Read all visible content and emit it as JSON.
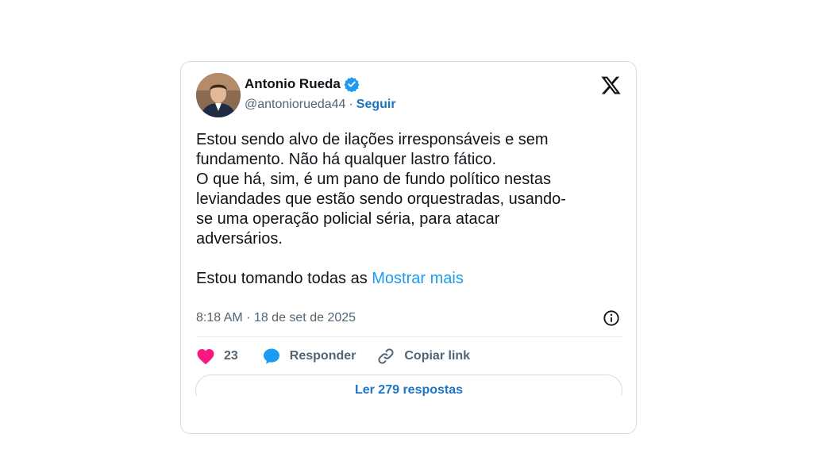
{
  "author": {
    "name": "Antonio Rueda",
    "handle": "@antoniorueda44",
    "separator": "·",
    "follow_label": "Seguir",
    "avatar_icon": "avatar-photo",
    "verified_icon": "verified-badge-icon"
  },
  "platform": {
    "logo_icon": "x-logo-icon"
  },
  "tweet": {
    "lines": [
      "Estou sendo alvo de ilações irresponsáveis e sem",
      "fundamento.  Não há qualquer lastro fático.",
      "O que há, sim, é um pano de fundo político nestas",
      "leviandades que estão sendo orquestradas, usando-",
      "se uma operação policial séria, para atacar",
      "adversários."
    ],
    "last_line_text": "Estou tomando todas as ",
    "show_more_label": "Mostrar mais"
  },
  "meta": {
    "timestamp": "8:18 AM · 18 de set de 2025",
    "info_icon": "info-icon"
  },
  "actions": {
    "like_count": "23",
    "reply_label": "Responder",
    "copy_link_label": "Copiar link"
  },
  "replies_button_label": "Ler 279 respostas",
  "colors": {
    "accent_link": "#1b74c4",
    "show_more": "#1d9bf0",
    "like_heart": "#f91880",
    "reply_bubble": "#1d9bf0",
    "text_primary": "#0f1419",
    "text_secondary": "#536471",
    "border": "#d6dde2"
  }
}
